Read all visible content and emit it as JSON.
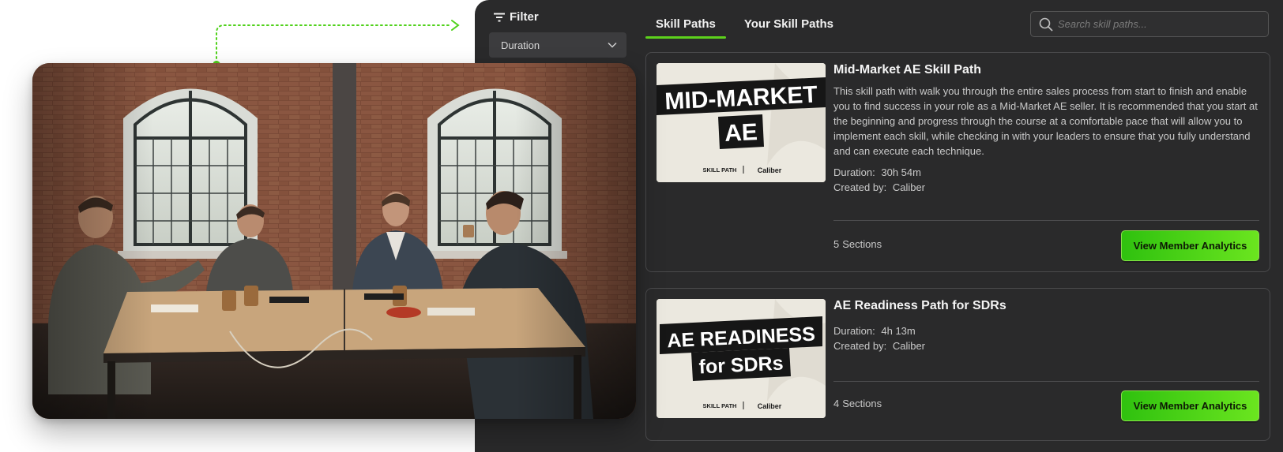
{
  "filter": {
    "title": "Filter",
    "duration_label": "Duration"
  },
  "tabs": [
    {
      "label": "Skill Paths",
      "active": true
    },
    {
      "label": "Your Skill Paths",
      "active": false
    }
  ],
  "search": {
    "placeholder": "Search skill paths..."
  },
  "colors": {
    "accent": "#5dd11c",
    "panel": "#2a2a2b",
    "button_start": "#2fc10f",
    "button_end": "#6be51f"
  },
  "skill_paths": [
    {
      "title": "Mid-Market AE Skill Path",
      "thumbnail": {
        "line1": "MID-MARKET",
        "line2": "AE",
        "tag": "SKILL PATH",
        "brand": "Caliber"
      },
      "description": "This skill path with walk you through the entire sales process from start to finish and enable you to find success in your role as a Mid-Market AE seller. It is recommended that you start at the beginning and progress through the course at a comfortable pace that will allow you to implement each skill, while checking in with your leaders to ensure that you fully understand and can execute each technique.",
      "duration_label": "Duration:",
      "duration": "30h 54m",
      "created_label": "Created by:",
      "created_by": "Caliber",
      "sections_count": "5",
      "sections_label": "Sections",
      "button": "View Member Analytics"
    },
    {
      "title": "AE Readiness Path for SDRs",
      "thumbnail": {
        "line1": "AE READINESS",
        "line2": "for SDRs",
        "tag": "SKILL PATH",
        "brand": "Caliber"
      },
      "duration_label": "Duration:",
      "duration": "4h 13m",
      "created_label": "Created by:",
      "created_by": "Caliber",
      "sections_count": "4",
      "sections_label": "Sections",
      "button": "View Member Analytics"
    }
  ]
}
